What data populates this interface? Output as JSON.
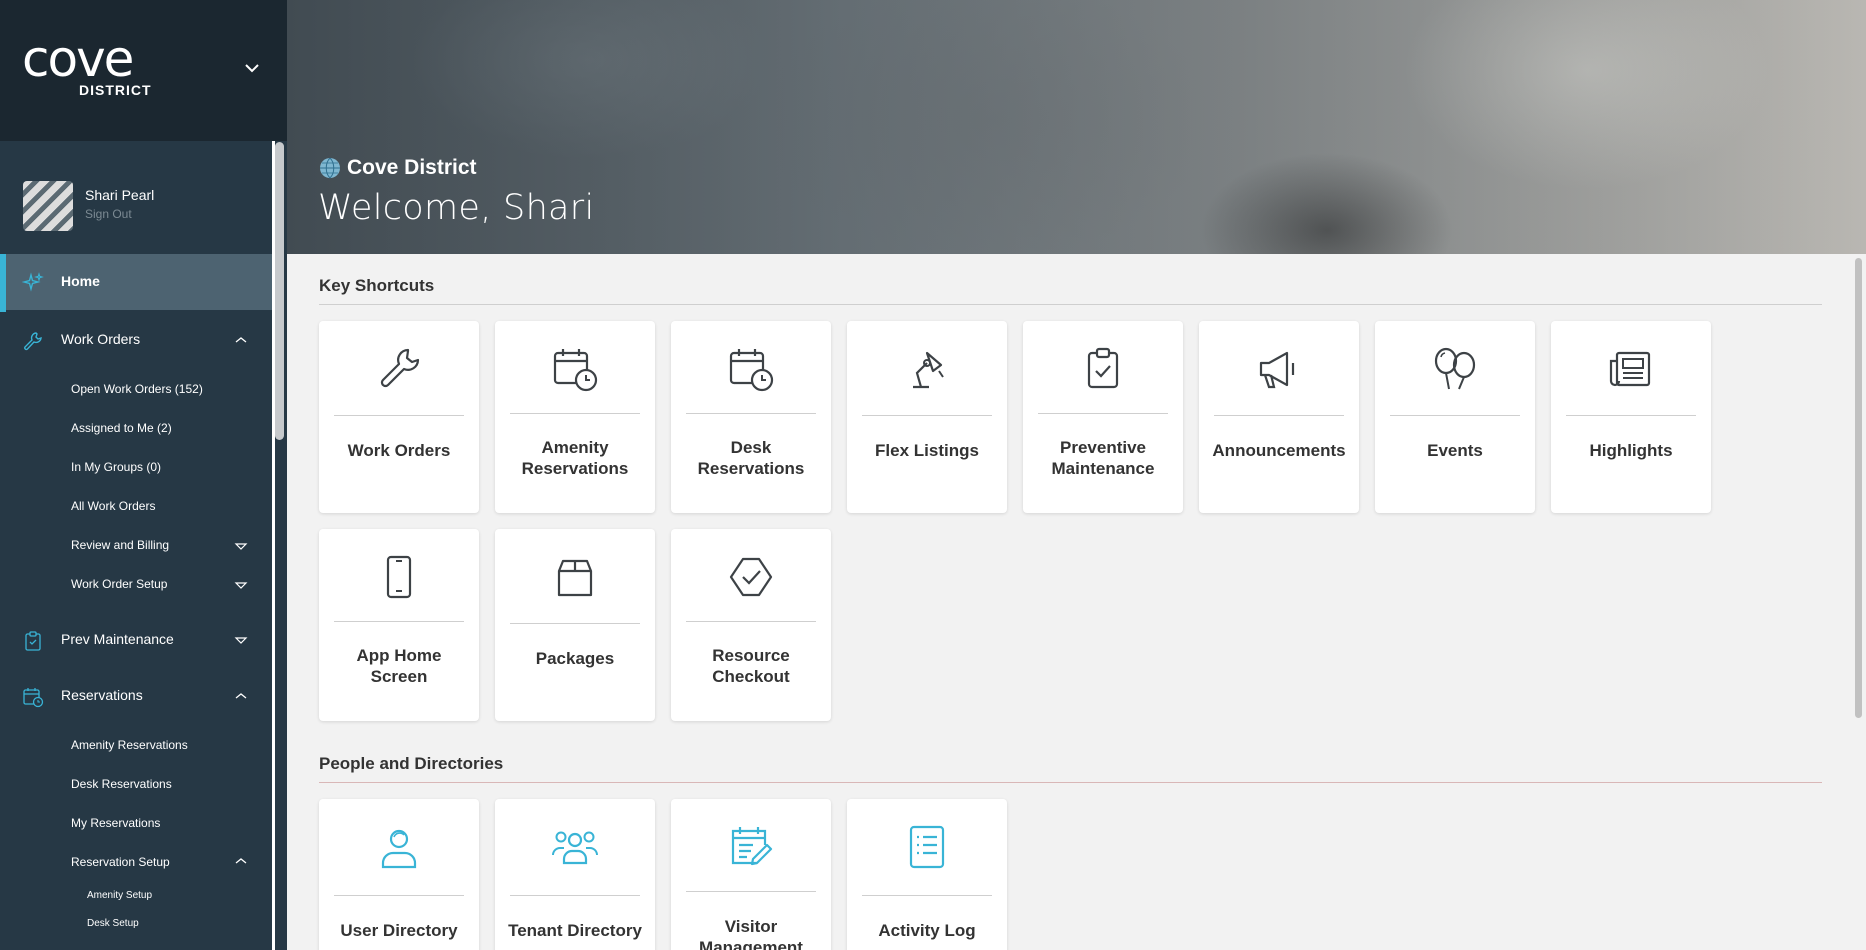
{
  "brand": {
    "logo_word": "cove",
    "logo_sub": "DISTRICT"
  },
  "user": {
    "name": "Shari Pearl",
    "signout": "Sign Out"
  },
  "nav": {
    "home": "Home",
    "work_orders": "Work Orders",
    "work_orders_items": [
      "Open Work Orders (152)",
      "Assigned to Me (2)",
      "In My Groups (0)",
      "All Work Orders",
      "Review and Billing",
      "Work Order Setup"
    ],
    "prev_maintenance": "Prev Maintenance",
    "reservations": "Reservations",
    "reservations_items": [
      "Amenity Reservations",
      "Desk Reservations",
      "My Reservations",
      "Reservation Setup"
    ],
    "reservation_setup_items": [
      "Amenity Setup",
      "Desk Setup"
    ]
  },
  "hero": {
    "site": "Cove District",
    "welcome": "Welcome, Shari"
  },
  "sections": {
    "key_shortcuts": "Key Shortcuts",
    "people": "People and Directories"
  },
  "shortcuts": [
    {
      "line1": "Work Orders",
      "line2": "",
      "icon": "wrench-icon"
    },
    {
      "line1": "Amenity",
      "line2": "Reservations",
      "icon": "calendar-clock-icon"
    },
    {
      "line1": "Desk",
      "line2": "Reservations",
      "icon": "calendar-clock-icon"
    },
    {
      "line1": "Flex Listings",
      "line2": "",
      "icon": "desk-lamp-icon"
    },
    {
      "line1": "Preventive",
      "line2": "Maintenance",
      "icon": "clipboard-check-icon"
    },
    {
      "line1": "Announcements",
      "line2": "",
      "icon": "megaphone-icon"
    },
    {
      "line1": "Events",
      "line2": "",
      "icon": "balloons-icon"
    },
    {
      "line1": "Highlights",
      "line2": "",
      "icon": "newspaper-icon"
    },
    {
      "line1": "App Home",
      "line2": "Screen",
      "icon": "phone-icon"
    },
    {
      "line1": "Packages",
      "line2": "",
      "icon": "package-icon"
    },
    {
      "line1": "Resource",
      "line2": "Checkout",
      "icon": "hexagon-check-icon"
    }
  ],
  "people": [
    {
      "line1": "User Directory",
      "line2": "",
      "icon": "user-icon"
    },
    {
      "line1": "Tenant Directory",
      "line2": "",
      "icon": "users-icon"
    },
    {
      "line1": "Visitor",
      "line2": "Management",
      "icon": "calendar-edit-icon"
    },
    {
      "line1": "Activity Log",
      "line2": "",
      "icon": "list-icon"
    }
  ],
  "colors": {
    "sidebar": "#263845",
    "brand_bg": "#1b2730",
    "accent": "#39b4d6",
    "active_nav": "#4d6371",
    "icon_dark": "#3d4246",
    "icon_blue": "#39b4d6"
  }
}
